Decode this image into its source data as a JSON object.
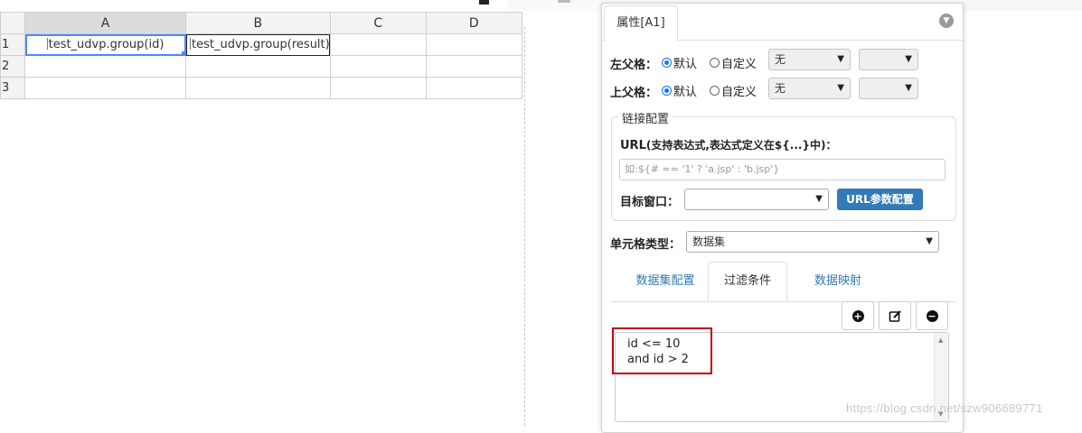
{
  "sheet": {
    "columns": [
      "A",
      "B",
      "C",
      "D"
    ],
    "rows": [
      "1",
      "2",
      "3"
    ],
    "cells": {
      "A1": "test_udvp.group(id)",
      "B1": "test_udvp.group(result)"
    }
  },
  "panel": {
    "tab_label": "属性[A1]",
    "left_parent": {
      "label": "左父格：",
      "opt_default": "默认",
      "opt_custom": "自定义",
      "select_value": "无",
      "select2_value": ""
    },
    "top_parent": {
      "label": "上父格：",
      "opt_default": "默认",
      "opt_custom": "自定义",
      "select_value": "无",
      "select2_value": ""
    },
    "link": {
      "legend": "链接配置",
      "url_label": "URL",
      "url_hint": "(支持表达式,表达式定义在${...}中)：",
      "url_placeholder": "如:${# == '1' ? 'a.jsp' : 'b.jsp'}",
      "target_label": "目标窗口：",
      "target_value": "",
      "url_params_button": "URL参数配置"
    },
    "cell_type": {
      "label": "单元格类型：",
      "value": "数据集"
    },
    "subtabs": [
      "数据集配置",
      "过滤条件",
      "数据映射"
    ],
    "active_subtab": "过滤条件",
    "filter_text": [
      "id <= 10",
      "and id > 2"
    ]
  },
  "watermark": "https://blog.csdn.net/szw906689771"
}
